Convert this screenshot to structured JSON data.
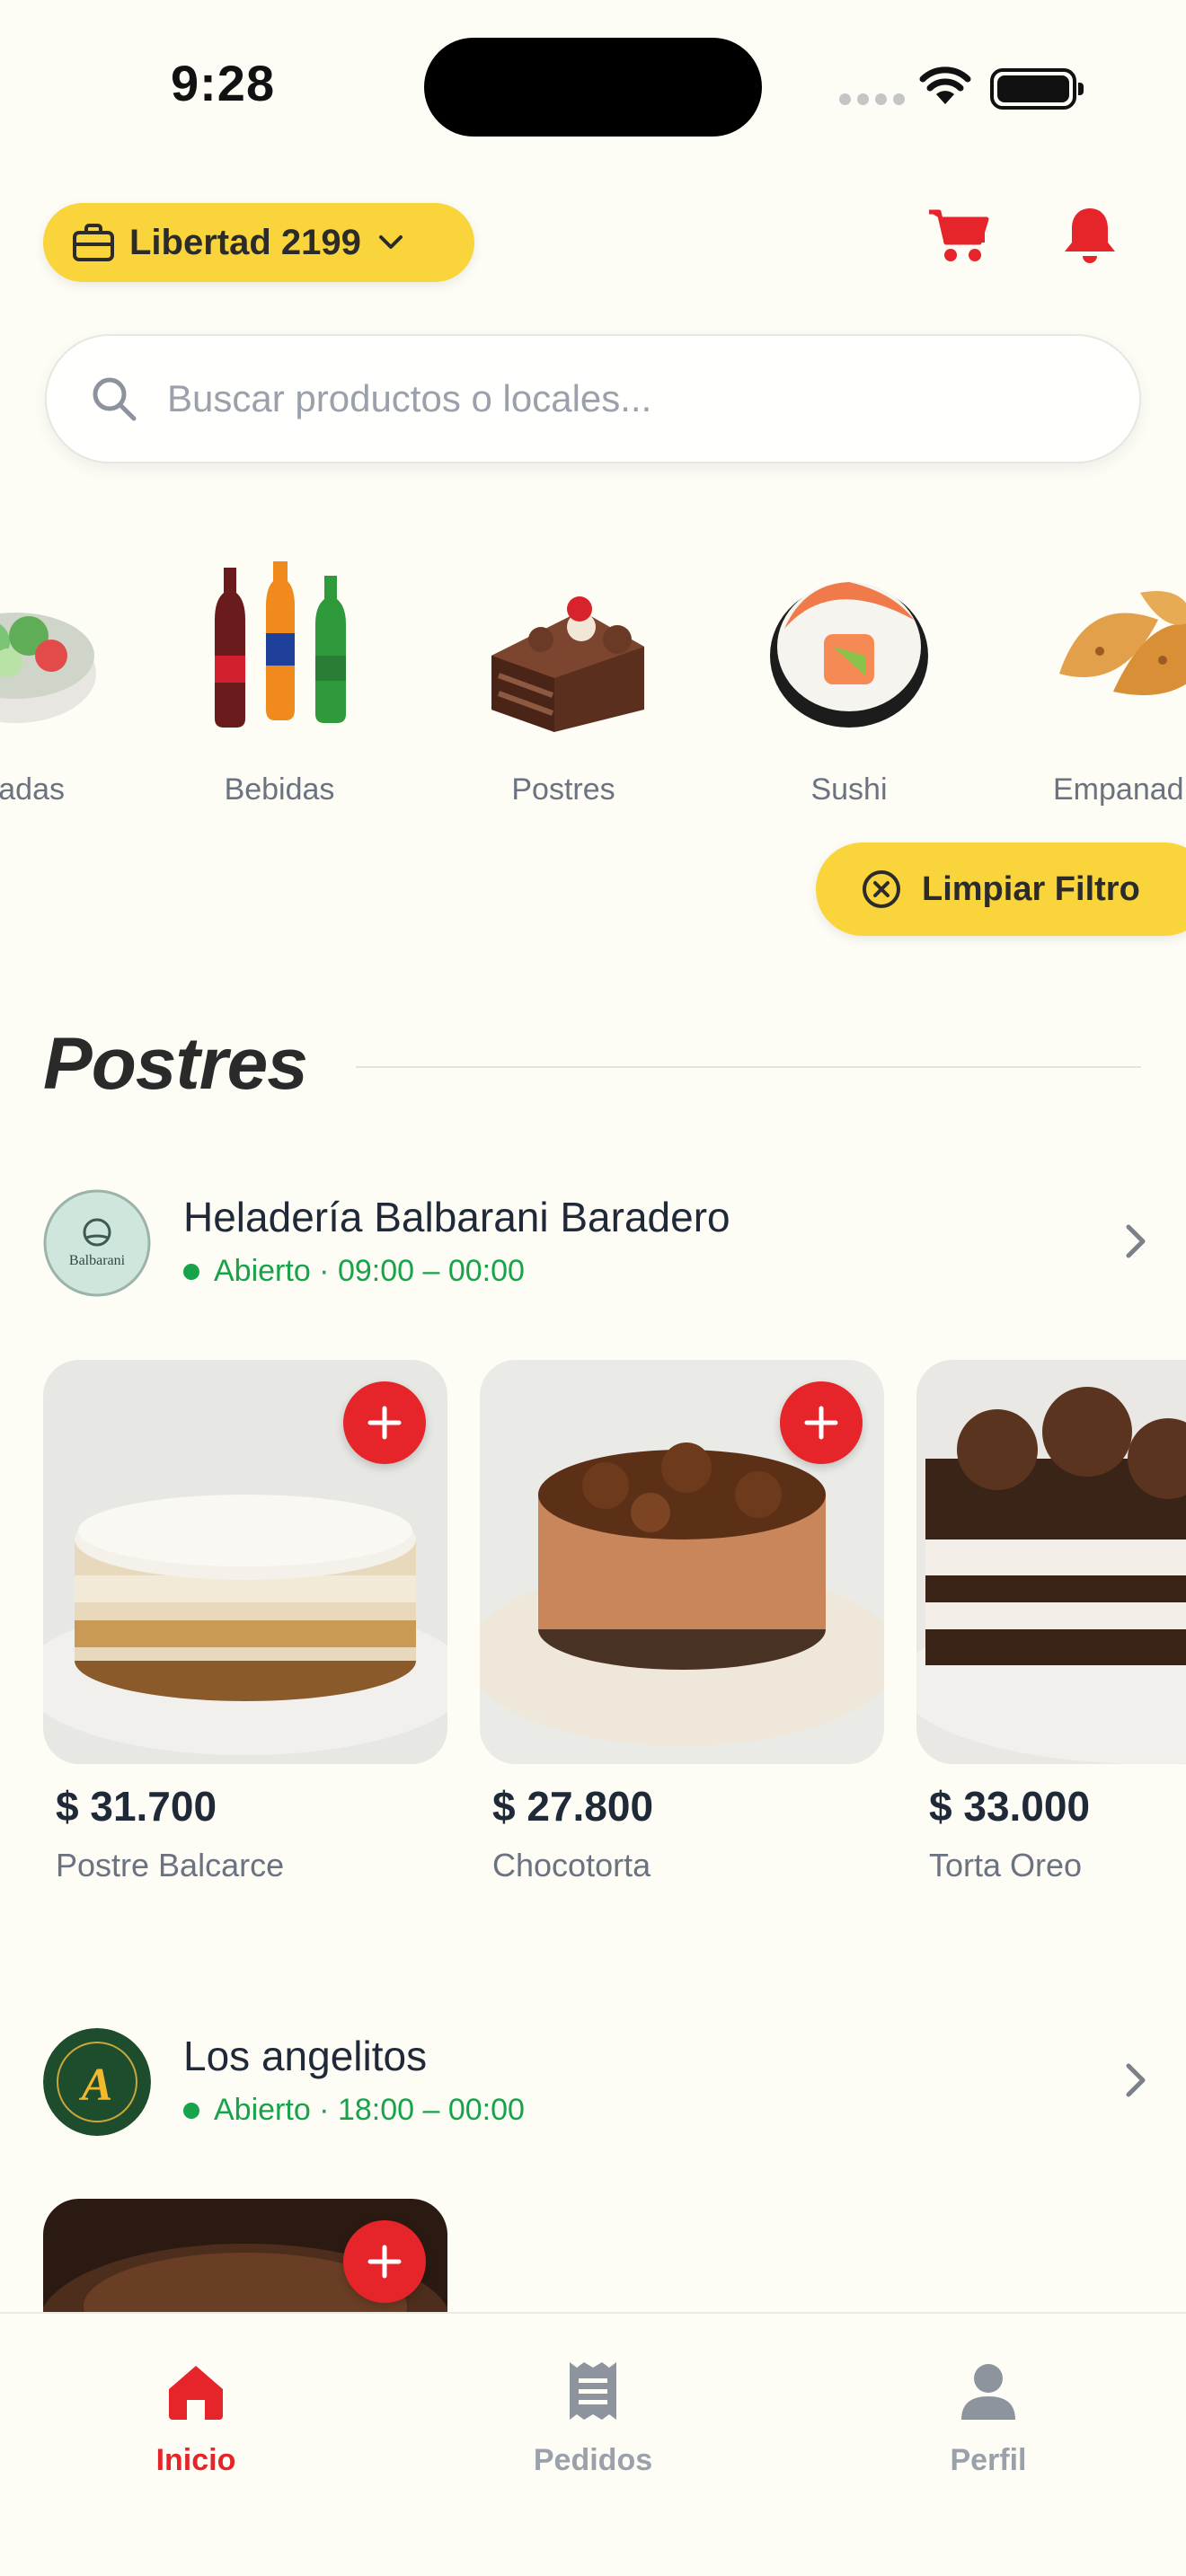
{
  "status_bar": {
    "time": "9:28"
  },
  "header": {
    "location": "Libertad 2199",
    "cart_icon": "cart-icon",
    "bell_icon": "bell-icon"
  },
  "search": {
    "placeholder": "Buscar productos o locales...",
    "value": ""
  },
  "categories": [
    {
      "label": "Ensaladas",
      "visible_label": "adas",
      "icon": "salad-icon"
    },
    {
      "label": "Bebidas",
      "icon": "drinks-icon"
    },
    {
      "label": "Postres",
      "icon": "cake-icon",
      "selected": true
    },
    {
      "label": "Sushi",
      "icon": "sushi-icon"
    },
    {
      "label": "Empanadas",
      "visible_label": "Empanad",
      "icon": "empanada-icon"
    }
  ],
  "clear_filter_label": "Limpiar Filtro",
  "section": {
    "title": "Postres"
  },
  "stores": [
    {
      "name": "Heladería Balbarani Baradero",
      "logo_text": "Balbarani",
      "status": "Abierto · 09:00 – 00:00",
      "products": [
        {
          "price": "$ 31.700",
          "name": "Postre Balcarce"
        },
        {
          "price": "$ 27.800",
          "name": "Chocotorta"
        },
        {
          "price": "$ 33.000",
          "name": "Torta Oreo"
        }
      ]
    },
    {
      "name": "Los angelitos",
      "logo_text": "A",
      "status": "Abierto · 18:00 – 00:00",
      "products": [
        {
          "price": "",
          "name": ""
        }
      ]
    }
  ],
  "bottom_nav": [
    {
      "label": "Inicio",
      "icon": "home-icon",
      "active": true
    },
    {
      "label": "Pedidos",
      "icon": "receipt-icon"
    },
    {
      "label": "Perfil",
      "icon": "profile-icon"
    }
  ],
  "colors": {
    "accent_red": "#e5252a",
    "accent_yellow": "#f9d43b",
    "open_green": "#16a34a",
    "background": "#fdfcf5"
  }
}
